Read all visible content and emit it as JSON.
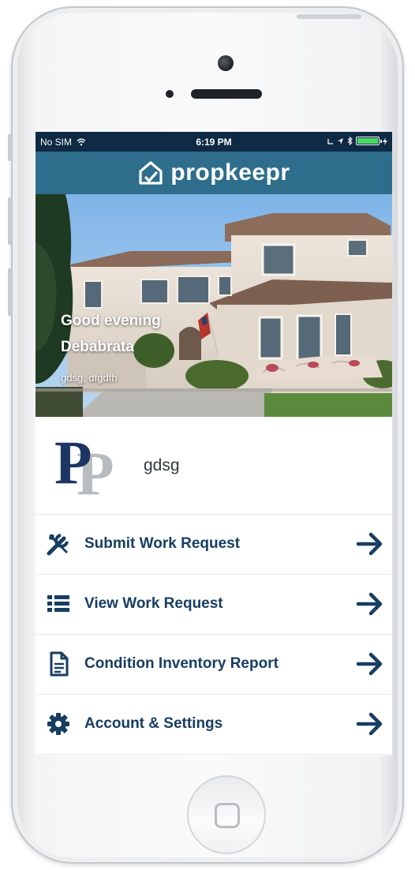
{
  "status_bar": {
    "carrier": "No SIM",
    "time": "6:19 PM"
  },
  "brand": {
    "name": "propkeepr",
    "color": "#2e6e8c"
  },
  "hero": {
    "greeting_line1": "Good evening",
    "greeting_line2": "Debabrata",
    "address": "gdsg, dfgdfh"
  },
  "profile": {
    "monogram": "PP",
    "name": "gdsg"
  },
  "menu": [
    {
      "label": "Submit Work Request",
      "icon": "tools-icon"
    },
    {
      "label": "View Work Request",
      "icon": "list-icon"
    },
    {
      "label": "Condition Inventory Report",
      "icon": "document-icon"
    },
    {
      "label": "Account & Settings",
      "icon": "gear-icon"
    }
  ],
  "colors": {
    "status_bar_bg": "#0f2a44",
    "menu_text": "#173d63",
    "arrow": "#173d63"
  }
}
